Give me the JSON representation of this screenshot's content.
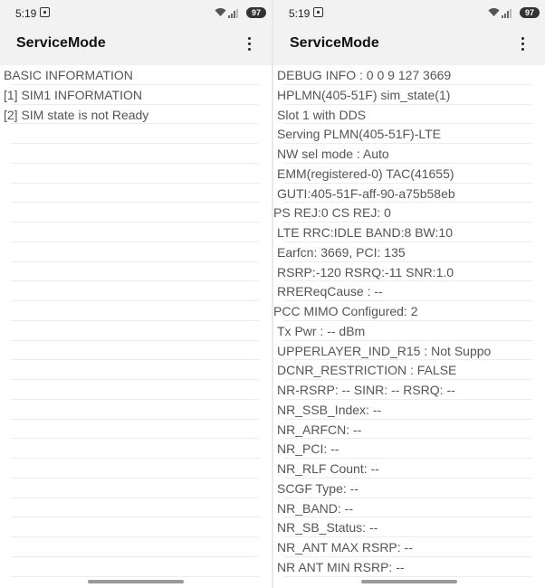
{
  "status_bar": {
    "time": "5:19",
    "battery": "97",
    "icons": [
      "screenshot-icon",
      "wifi-icon",
      "signal-icon",
      "battery-icon"
    ]
  },
  "app_bar": {
    "title": "ServiceMode",
    "menu_icon": "more-vert-icon"
  },
  "left_panel": {
    "rows": [
      "BASIC INFORMATION",
      "[1] SIM1 INFORMATION",
      "[2] SIM state is not Ready",
      "",
      "",
      "",
      "",
      "",
      "",
      "",
      "",
      "",
      "",
      "",
      "",
      "",
      "",
      "",
      "",
      "",
      "",
      "",
      "",
      "",
      "",
      ""
    ]
  },
  "right_panel": {
    "rows": [
      "DEBUG INFO : 0 0 9 127 3669",
      "HPLMN(405-51F) sim_state(1)",
      "Slot 1 with DDS",
      "Serving PLMN(405-51F)-LTE",
      "NW sel mode : Auto",
      "EMM(registered-0) TAC(41655)",
      "GUTI:405-51F-aff-90-a75b58eb",
      "PS REJ:0 CS REJ: 0",
      "LTE RRC:IDLE BAND:8 BW:10",
      "Earfcn: 3669, PCI: 135",
      "RSRP:-120 RSRQ:-11 SNR:1.0",
      "RREReqCause : --",
      "PCC MIMO Configured: 2",
      "Tx Pwr : -- dBm",
      "UPPERLAYER_IND_R15 : Not Suppo",
      "DCNR_RESTRICTION : FALSE",
      "NR-RSRP: -- SINR: -- RSRQ: --",
      "NR_SSB_Index: --",
      "NR_ARFCN: --",
      "NR_PCI: --",
      "NR_RLF Count: --",
      "SCGF Type: --",
      "NR_BAND: --",
      "NR_SB_Status: --",
      "NR_ANT MAX RSRP: --",
      "NR  ANT MIN RSRP: --"
    ]
  }
}
